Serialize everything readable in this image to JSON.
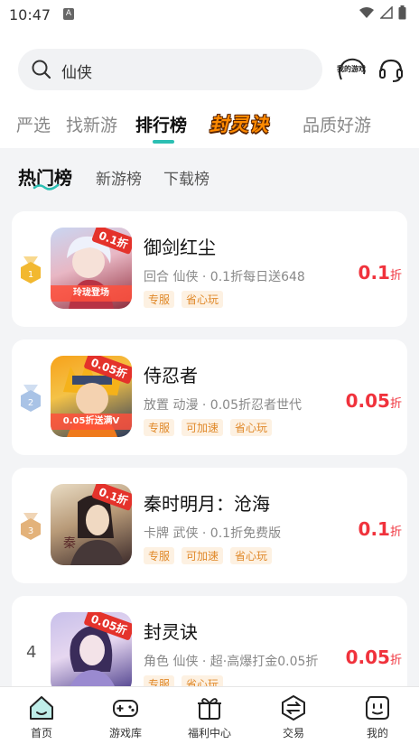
{
  "status_bar": {
    "time": "10:47",
    "notification_badge": "A"
  },
  "search": {
    "query": "仙侠",
    "my_games_label": "我的游戏"
  },
  "top_tabs": [
    {
      "label": "严选",
      "active": false
    },
    {
      "label": "找新游",
      "active": false
    },
    {
      "label": "排行榜",
      "active": true
    },
    {
      "label": "封灵诀",
      "active": false,
      "promo": true
    },
    {
      "label": "品质好游",
      "active": false
    }
  ],
  "sub_tabs": [
    {
      "label": "热门榜",
      "active": true
    },
    {
      "label": "新游榜",
      "active": false
    },
    {
      "label": "下载榜",
      "active": false
    }
  ],
  "games": [
    {
      "rank": "1",
      "rank_color": "#f2b830",
      "name": "御剑红尘",
      "meta": "回合 仙侠 · 0.1折每日送648",
      "tags": [
        "专服",
        "省心玩"
      ],
      "discount": "0.1",
      "discount_unit": "折",
      "cover_badge": "0.1折",
      "cover_ribbon": "玲珑登场",
      "cover_colors": [
        "#c9d6f2",
        "#8f2d3c"
      ]
    },
    {
      "rank": "2",
      "rank_color": "#a9c3e6",
      "name": "侍忍者",
      "meta": "放置 动漫 · 0.05折忍者世代",
      "tags": [
        "专服",
        "可加速",
        "省心玩"
      ],
      "discount": "0.05",
      "discount_unit": "折",
      "cover_badge": "0.05折",
      "cover_ribbon": "0.05折送满V",
      "cover_colors": [
        "#f7a21b",
        "#2a3a5c"
      ]
    },
    {
      "rank": "3",
      "rank_color": "#e3b27a",
      "name": "秦时明月：沧海",
      "meta": "卡牌 武侠 · 0.1折免费版",
      "tags": [
        "专服",
        "可加速",
        "省心玩"
      ],
      "discount": "0.1",
      "discount_unit": "折",
      "cover_badge": "0.1折",
      "cover_ribbon": "",
      "cover_colors": [
        "#e9dcc4",
        "#3b2a2a"
      ]
    },
    {
      "rank": "4",
      "rank_color": "",
      "name": "封灵诀",
      "meta": "角色 仙侠 · 超·高爆打金0.05折",
      "tags": [
        "专服",
        "省心玩"
      ],
      "discount": "0.05",
      "discount_unit": "折",
      "cover_badge": "0.05折",
      "cover_ribbon": "",
      "cover_colors": [
        "#c8c0ea",
        "#4a3c8a"
      ]
    }
  ],
  "bottom_nav": [
    {
      "label": "首页",
      "icon": "home-icon",
      "active": true
    },
    {
      "label": "游戏库",
      "icon": "gamepad-icon",
      "active": false
    },
    {
      "label": "福利中心",
      "icon": "gift-icon",
      "active": false
    },
    {
      "label": "交易",
      "icon": "exchange-icon",
      "active": false
    },
    {
      "label": "我的",
      "icon": "profile-icon",
      "active": false
    }
  ],
  "colors": {
    "accent": "#2bbfb3",
    "price": "#f0323c",
    "tag_text": "#e0892a",
    "tag_bg": "#fdf1e2"
  }
}
